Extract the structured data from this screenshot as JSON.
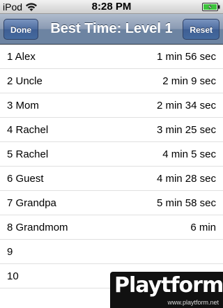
{
  "status_bar": {
    "carrier": "iPod",
    "time": "8:28 PM",
    "wifi_icon": "wifi-icon",
    "battery_icon": "battery-charging-icon"
  },
  "nav": {
    "title": "Best Time: Level 1",
    "done_label": "Done",
    "reset_label": "Reset"
  },
  "rows": [
    {
      "name": "1 Alex",
      "time": "1 min 56 sec"
    },
    {
      "name": "2 Uncle",
      "time": "2 min 9 sec"
    },
    {
      "name": "3 Mom",
      "time": "2 min 34 sec"
    },
    {
      "name": "4 Rachel",
      "time": "3 min 25 sec"
    },
    {
      "name": "5 Rachel",
      "time": "4 min 5 sec"
    },
    {
      "name": "6 Guest",
      "time": "4 min 28 sec"
    },
    {
      "name": "7 Grandpa",
      "time": "5 min 58 sec"
    },
    {
      "name": "8 Grandmom",
      "time": "6 min"
    },
    {
      "name": "9",
      "time": ""
    },
    {
      "name": "10",
      "time": ""
    }
  ],
  "watermark": {
    "logo_text": "Playtform",
    "url": "www.playtform.net"
  },
  "colors": {
    "nav_bar": "#6d84a2",
    "nav_button": "#446a9e",
    "row_divider": "#e0e0e0"
  }
}
